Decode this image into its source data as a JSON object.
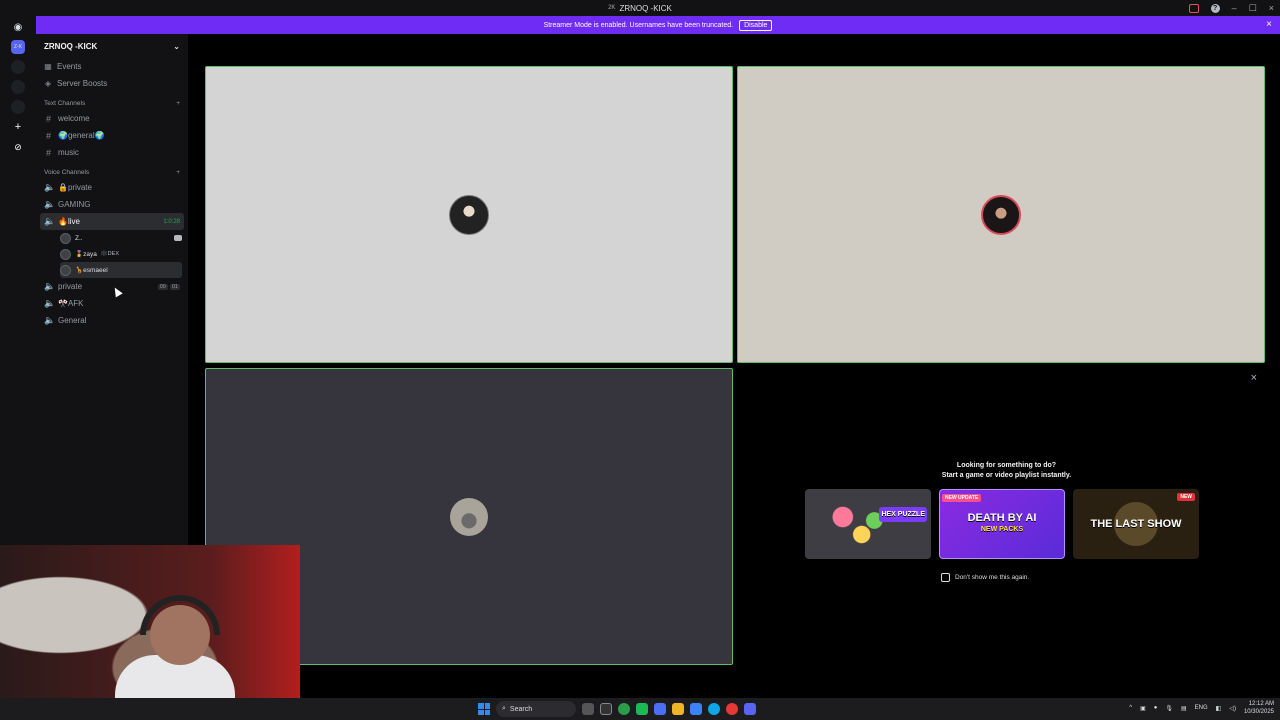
{
  "window": {
    "title": "ZRNOQ -KICK",
    "logo_text": "2K"
  },
  "banner": {
    "text": "Streamer Mode is enabled. Usernames have been truncated.",
    "button": "Disable",
    "close": "×"
  },
  "guilds": [
    {
      "name": "discord-home-icon",
      "label": ""
    },
    {
      "name": "server-zk",
      "label": "Z-K"
    },
    {
      "name": "server-2",
      "label": ""
    },
    {
      "name": "server-3",
      "label": ""
    },
    {
      "name": "server-4",
      "label": ""
    }
  ],
  "server": {
    "name": "ZRNOQ -KICK"
  },
  "nav": [
    {
      "label": "Events"
    },
    {
      "label": "Server Boosts"
    }
  ],
  "text_category": "Text Channels",
  "text_channels": [
    {
      "label": "welcome"
    },
    {
      "label": "🌍general🌍"
    },
    {
      "label": "music"
    }
  ],
  "voice_category": "Voice Channels",
  "voice_channels_top": [
    {
      "label": "🔒private"
    },
    {
      "label": "GAMING"
    }
  ],
  "live_channel": {
    "label": "🔥live",
    "time": "1:0:28"
  },
  "voice_users": [
    {
      "name": "Z..",
      "tag": ""
    },
    {
      "name": "🎖️zaya",
      "tag": "🕸️DEX"
    },
    {
      "name": "🦒esmaeel",
      "tag": ""
    }
  ],
  "voice_channels_bottom": [
    {
      "label": "private",
      "badge1": "00",
      "badge2": "01"
    },
    {
      "label": "🎌AFK"
    },
    {
      "label": "General"
    }
  ],
  "activity": {
    "title": "Looking for something to do?",
    "subtitle": "Start a game or video playlist instantly.",
    "games": [
      {
        "label": "HEX PUZZLE",
        "tag": ""
      },
      {
        "label": "DEATH BY AI",
        "sub": "NEW PACKS",
        "tag": "NEW UPDATE"
      },
      {
        "label": "THE LAST SHOW",
        "tag": "NEW"
      }
    ],
    "dont_show": "Don't show me this again."
  },
  "taskbar": {
    "search": "Search",
    "lang": "ENG",
    "time": "12:12 AM",
    "date": "10/30/2025"
  }
}
